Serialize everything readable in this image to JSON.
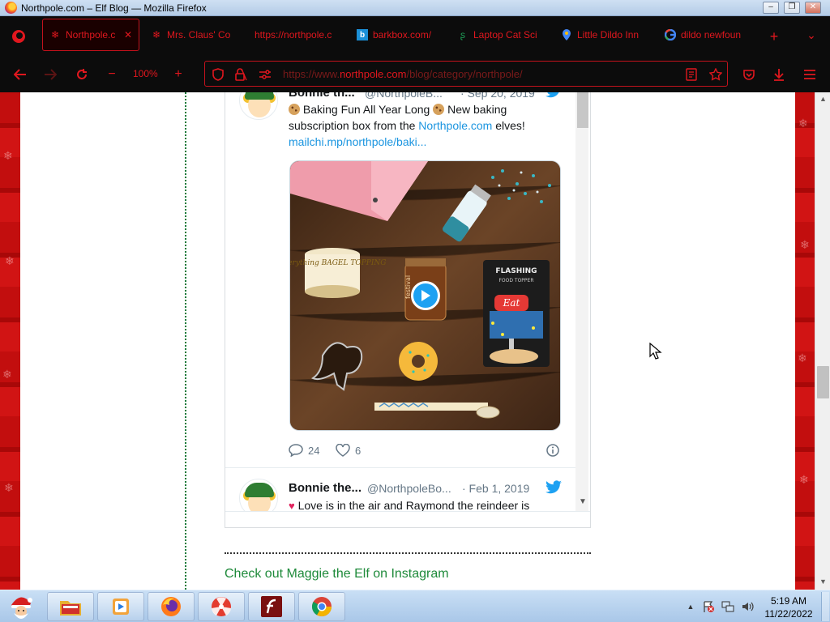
{
  "window": {
    "title": "Northpole.com – Elf Blog — Mozilla Firefox",
    "min": "–",
    "max": "❐",
    "close": "✕"
  },
  "tabs": [
    {
      "label": "Northpole.c",
      "icon": "snowflake-icon",
      "active": true,
      "close": "✕"
    },
    {
      "label": "Mrs. Claus' Co",
      "icon": "snowflake-icon"
    },
    {
      "label": "https://northpole.c",
      "icon": ""
    },
    {
      "label": "barkbox.com/",
      "icon": "barkbox-icon"
    },
    {
      "label": "Laptop Cat Sci",
      "icon": "science-icon"
    },
    {
      "label": "Little Dildo Inn",
      "icon": "map-pin-icon"
    },
    {
      "label": "dildo newfoun",
      "icon": "google-icon"
    }
  ],
  "tabbar": {
    "new_tab": "+",
    "list_all": "⌄"
  },
  "nav": {
    "zoom": "100%",
    "zoom_out": "−",
    "zoom_in": "+",
    "url_prefix": "https://www.",
    "url_domain": "northpole.com",
    "url_path": "/blog/category/northpole/"
  },
  "tweets": {
    "first": {
      "name": "Bonnie th...",
      "handle": "@NorthpoleB...",
      "date": "· Sep 20, 2019",
      "text_1": " Baking Fun All Year Long ",
      "text_2": " New baking",
      "text_line2_pre": "subscription box from the ",
      "text_line2_link": "Northpole.com",
      "text_line2_post": " elves!",
      "link": "mailchi.mp/northpole/baki...",
      "replies": "24",
      "likes": "6",
      "media_labels": {
        "jar_label": "Everything BAGEL TOPPING",
        "box_label": "FLASHING",
        "box_sub": "FOOD TOPPER",
        "sign_label": "Eat",
        "tall_jar_label": "festival"
      }
    },
    "second": {
      "name": "Bonnie the...",
      "handle": "@NorthpoleBo...",
      "date": "· Feb 1, 2019",
      "text": " Love is in the air and Raymond the reindeer is"
    }
  },
  "page": {
    "instagram_link": "Check out Maggie the Elf on Instagram"
  },
  "taskbar": {
    "time": "5:19 AM",
    "date": "11/22/2022"
  },
  "colors": {
    "accent_red": "#e0171e",
    "twitter_blue": "#1da1f2",
    "link_green": "#1e8a3a"
  }
}
